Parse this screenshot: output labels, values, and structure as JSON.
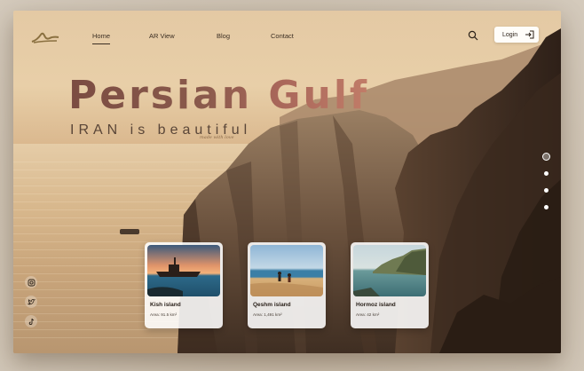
{
  "nav": {
    "items": [
      {
        "label": "Home",
        "active": true
      },
      {
        "label": "AR View",
        "active": false
      },
      {
        "label": "Blog",
        "active": false
      },
      {
        "label": "Contact",
        "active": false
      }
    ],
    "login_label": "Login",
    "logo_icon": "logo-mark-icon",
    "search_icon": "search-icon",
    "login_icon": "sign-in-arrow-icon"
  },
  "hero": {
    "title": "Persian Gulf",
    "subtitle": "IRAN is beautiful",
    "signature": "made with love"
  },
  "slider": {
    "total": 4,
    "active_index": 0
  },
  "social": [
    "instagram-icon",
    "twitter-icon",
    "tiktok-icon"
  ],
  "cards": [
    {
      "name": "Kish island",
      "area": "Area: 91.5 km²",
      "image": "shipwreck-sunset"
    },
    {
      "name": "Qeshm island",
      "area": "Area: 1,491 km²",
      "image": "beach-couple"
    },
    {
      "name": "Hormoz island",
      "area": "Area: 42 km²",
      "image": "sea-cliff"
    }
  ],
  "colors": {
    "title_gradient_start": "#7b4c42",
    "title_gradient_end": "#c17c68",
    "text_dark": "#3b2e22"
  }
}
